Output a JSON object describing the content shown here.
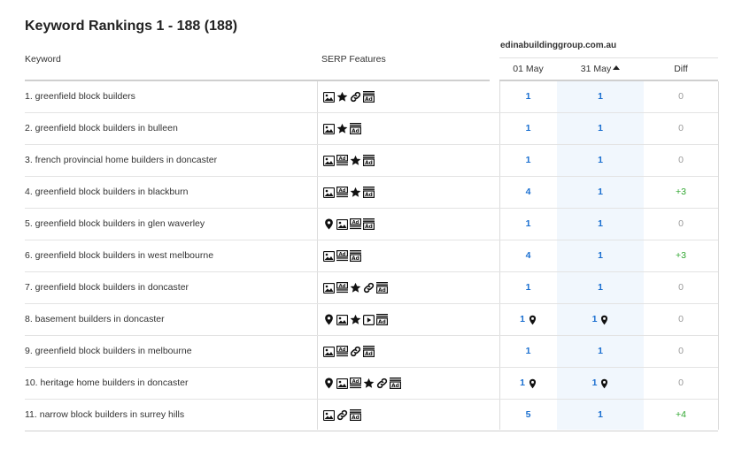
{
  "title": "Keyword Rankings 1 - 188 (188)",
  "headers": {
    "keyword": "Keyword",
    "serp": "SERP Features",
    "domain": "edinabuildinggroup.com.au",
    "date1": "01 May",
    "date2": "31 May",
    "diff": "Diff"
  },
  "colors": {
    "position": "#1a6fd0",
    "diff_positive": "#2ea62e",
    "diff_zero": "#999999",
    "highlight_column": "#f1f7fd"
  },
  "rows": [
    {
      "keyword": "1. greenfield block builders",
      "serp": [
        "image-icon",
        "star-icon",
        "link-icon",
        "ad-icon"
      ],
      "pos1": "1",
      "pos2": "1",
      "diff": "0",
      "pin1": false,
      "pin2": false
    },
    {
      "keyword": "2. greenfield block builders in bulleen",
      "serp": [
        "image-icon",
        "star-icon",
        "ad-icon"
      ],
      "pos1": "1",
      "pos2": "1",
      "diff": "0",
      "pin1": false,
      "pin2": false
    },
    {
      "keyword": "3. french provincial home builders in doncaster",
      "serp": [
        "image-icon",
        "ad-top-icon",
        "star-icon",
        "ad-icon"
      ],
      "pos1": "1",
      "pos2": "1",
      "diff": "0",
      "pin1": false,
      "pin2": false
    },
    {
      "keyword": "4. greenfield block builders in blackburn",
      "serp": [
        "image-icon",
        "ad-top-icon",
        "star-icon",
        "ad-icon"
      ],
      "pos1": "4",
      "pos2": "1",
      "diff": "+3",
      "pin1": false,
      "pin2": false
    },
    {
      "keyword": "5. greenfield block builders in glen waverley",
      "serp": [
        "pin-icon",
        "image-icon",
        "ad-top-icon",
        "ad-icon"
      ],
      "pos1": "1",
      "pos2": "1",
      "diff": "0",
      "pin1": false,
      "pin2": false
    },
    {
      "keyword": "6. greenfield block builders in west melbourne",
      "serp": [
        "image-icon",
        "ad-top-icon",
        "ad-icon"
      ],
      "pos1": "4",
      "pos2": "1",
      "diff": "+3",
      "pin1": false,
      "pin2": false
    },
    {
      "keyword": "7. greenfield block builders in doncaster",
      "serp": [
        "image-icon",
        "ad-top-icon",
        "star-icon",
        "link-icon",
        "ad-icon"
      ],
      "pos1": "1",
      "pos2": "1",
      "diff": "0",
      "pin1": false,
      "pin2": false
    },
    {
      "keyword": "8. basement builders in doncaster",
      "serp": [
        "pin-icon",
        "image-icon",
        "star-icon",
        "video-icon",
        "ad-icon"
      ],
      "pos1": "1",
      "pos2": "1",
      "diff": "0",
      "pin1": true,
      "pin2": true
    },
    {
      "keyword": "9. greenfield block builders in melbourne",
      "serp": [
        "image-icon",
        "ad-top-icon",
        "link-icon",
        "ad-icon"
      ],
      "pos1": "1",
      "pos2": "1",
      "diff": "0",
      "pin1": false,
      "pin2": false
    },
    {
      "keyword": "10. heritage home builders in doncaster",
      "serp": [
        "pin-icon",
        "image-icon",
        "ad-top-icon",
        "star-icon",
        "link-icon",
        "ad-icon"
      ],
      "pos1": "1",
      "pos2": "1",
      "diff": "0",
      "pin1": true,
      "pin2": true
    },
    {
      "keyword": "11. narrow block builders in surrey hills",
      "serp": [
        "image-icon",
        "link-icon",
        "ad-icon"
      ],
      "pos1": "5",
      "pos2": "1",
      "diff": "+4",
      "pin1": false,
      "pin2": false
    }
  ]
}
